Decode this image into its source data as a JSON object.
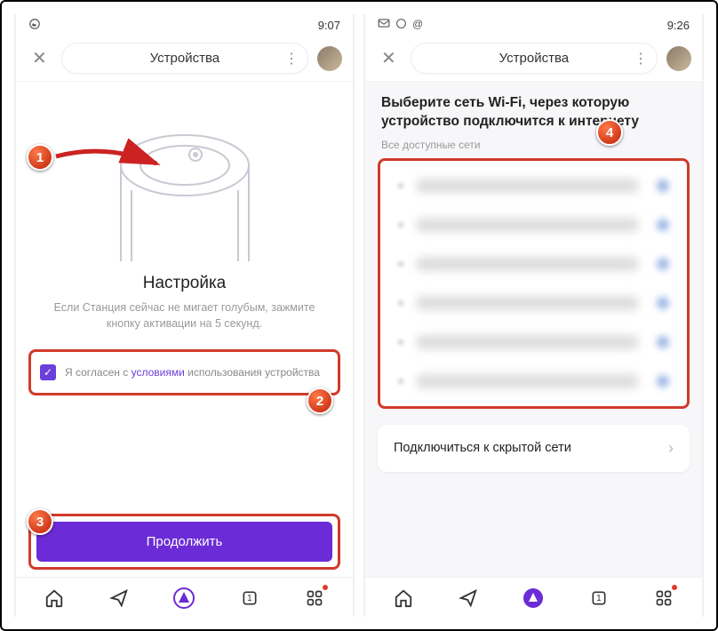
{
  "left": {
    "status_time": "9:07",
    "app_title": "Устройства",
    "setup_title": "Настройка",
    "setup_desc": "Если Станция сейчас не мигает голубым, зажмите кнопку активации на 5 секунд.",
    "consent_prefix": "Я согласен с ",
    "consent_link": "условиями",
    "consent_suffix": " использования устройства",
    "continue_label": "Продолжить"
  },
  "right": {
    "status_time": "9:26",
    "app_title": "Устройства",
    "wifi_heading": "Выберите сеть Wi-Fi, через которую устройство подключится к интернету",
    "wifi_sub": "Все доступные сети",
    "hidden_label": "Подключиться к скрытой сети"
  },
  "steps": {
    "s1": "1",
    "s2": "2",
    "s3": "3",
    "s4": "4"
  },
  "colors": {
    "accent": "#6b2bd6",
    "highlight": "#d13a2a"
  }
}
